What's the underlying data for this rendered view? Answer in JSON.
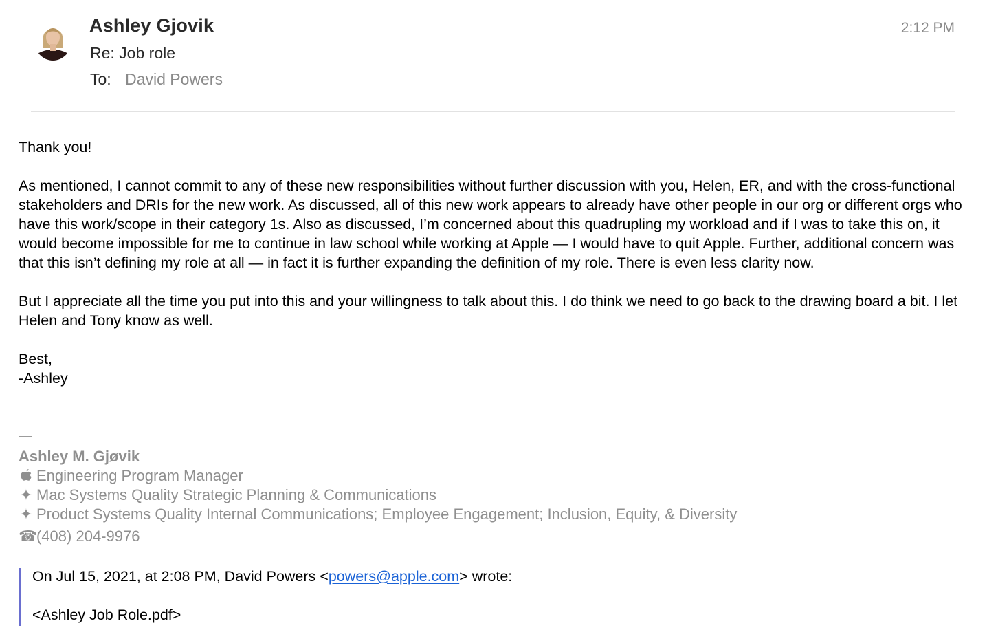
{
  "header": {
    "sender": "Ashley Gjovik",
    "subject": "Re: Job role",
    "to_label": "To:",
    "to_value": "David Powers",
    "time": "2:12 PM"
  },
  "body": {
    "paragraphs": [
      "Thank you!",
      "As mentioned, I cannot commit to any of these new responsibilities without further discussion with you, Helen, ER, and with the cross-functional stakeholders and DRIs for the new work. As discussed, all of this new work appears to already have other people in our org or different orgs who have this work/scope in their category 1s. Also as discussed, I’m concerned about this quadrupling my workload and if I was to take this on, it would become impossible for me to continue in law school while working at Apple — I would have to quit Apple. Further, additional concern was that this isn’t defining my role at all — in fact it is further expanding the definition of my role. There is even less clarity now.",
      "But I appreciate all the time you put into this and your willingness to talk about this. I do think we need to go back to the drawing board a bit. I let Helen and Tony know as well."
    ],
    "closing": "Best,",
    "signoff": "-Ashley"
  },
  "signature": {
    "dash": "—",
    "name": "Ashley M. Gjøvik",
    "title_icon": "",
    "title": "Engineering Program Manager",
    "bullet_icon": "✦",
    "role1": "Mac Systems Quality Strategic Planning & Communications",
    "role2": "Product Systems Quality Internal Communications; Employee Engagement; Inclusion, Equity, & Diversity",
    "phone_icon": "☎",
    "phone": "(408) 204-9976"
  },
  "quote": {
    "intro_prefix": "On Jul 15, 2021, at 2:08 PM, David Powers <",
    "email": "powers@apple.com",
    "intro_suffix": "> wrote:",
    "attachment": "<Ashley Job Role.pdf>"
  },
  "colors": {
    "quote_bar": "#6a6fd0",
    "link": "#1a62d6",
    "muted": "#8a8a8a"
  }
}
